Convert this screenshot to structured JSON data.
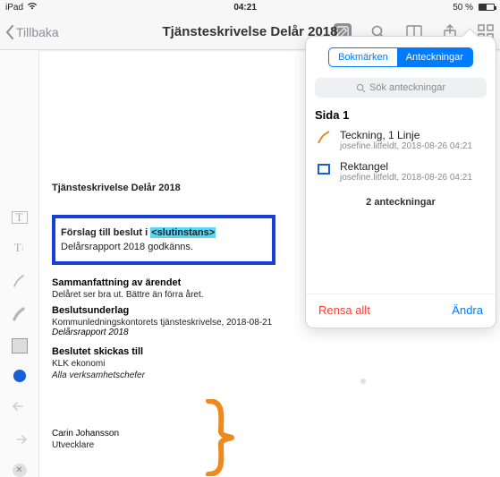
{
  "status": {
    "device": "iPad",
    "wifi": true,
    "time": "04:21",
    "battery_pct": "50 %"
  },
  "nav": {
    "back": "Tillbaka",
    "title": "Tjänsteskrivelse Delår 2018"
  },
  "panel": {
    "tabs": {
      "bookmarks": "Bokmärken",
      "annotations": "Anteckningar"
    },
    "search_placeholder": "Sök anteckningar",
    "section": "Sida 1",
    "items": [
      {
        "title": "Teckning, 1 Linje",
        "meta": "josefine.litfeldt, 2018-08-26 04:21"
      },
      {
        "title": "Rektangel",
        "meta": "josefine.litfeldt, 2018-08-26 04:21"
      }
    ],
    "count": "2 anteckningar",
    "clear": "Rensa allt",
    "edit": "Ändra"
  },
  "doc": {
    "title": "Tjänsteskrivelse Delår 2018",
    "proposal_prefix": "Förslag till beslut i ",
    "proposal_highlight": "<slutinstans>",
    "proposal_line2": "Delårsrapport 2018 godkänns.",
    "summary_h": "Sammanfattning av ärendet",
    "summary_p": "Delåret ser bra ut. Bättre än förra året.",
    "basis_h": "Beslutsunderlag",
    "basis_p": "Kommunledningskontorets tjänsteskrivelse, 2018-08-21",
    "basis_em": "Delårsrapport 2018",
    "sendto_h": "Beslutet skickas till",
    "sendto_1": "KLK ekonomi",
    "sendto_2": "Alla verksamhetschefer",
    "signer_name": "Carin Johansson",
    "signer_role": "Utvecklare"
  }
}
